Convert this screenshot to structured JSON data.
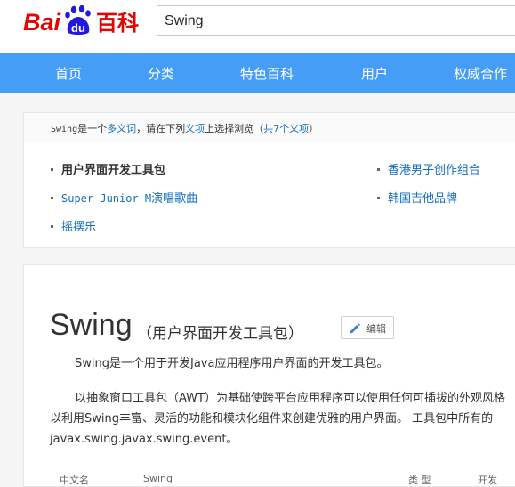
{
  "header": {
    "logo": {
      "text_left": "Bai",
      "paw_text": "du",
      "text_right": "百科"
    },
    "search": {
      "value": "Swing"
    }
  },
  "nav": {
    "items": [
      "首页",
      "分类",
      "特色百科",
      "用户",
      "权威合作"
    ]
  },
  "polysemy": {
    "term": "Swing",
    "text_1": "是一个",
    "link_1": "多义词",
    "text_2": "，请在下列",
    "link_2": "义项",
    "text_3": "上选择浏览（",
    "link_3": "共7个义项",
    "text_4": "）",
    "senses_left": [
      {
        "label": "用户界面开发工具包",
        "current": true
      },
      {
        "label_mono": "Super Junior-M",
        "label": "演唱歌曲",
        "current": false
      },
      {
        "label": "摇摆乐",
        "current": false
      }
    ],
    "senses_right": [
      {
        "label": "香港男子创作组合"
      },
      {
        "label": "韩国吉他品牌"
      }
    ]
  },
  "article": {
    "title": "Swing",
    "subtitle": "（用户界面开发工具包）",
    "edit_label": "编辑",
    "para1": "Swing是一个用于开发Java应用程序用户界面的开发工具包。",
    "para2_line1": "以抽象窗口工具包（AWT）为基础使跨平台应用程序可以使用任何可插拔的外观风格",
    "para2_line2": "以利用Swing丰富、灵活的功能和模块化组件来创建优雅的用户界面。 工具包中所有的",
    "para2_line3": "javax.swing.javax.swing.event。",
    "infobox_row_left": "中文名",
    "infobox_row_mid": "Swing",
    "infobox_row_right_label": "类    型",
    "infobox_row_right_val": "开发"
  },
  "colors": {
    "brand_red": "#e10601",
    "brand_blue": "#2319dc",
    "nav_blue": "#459df5",
    "link_blue": "#136ec2"
  }
}
